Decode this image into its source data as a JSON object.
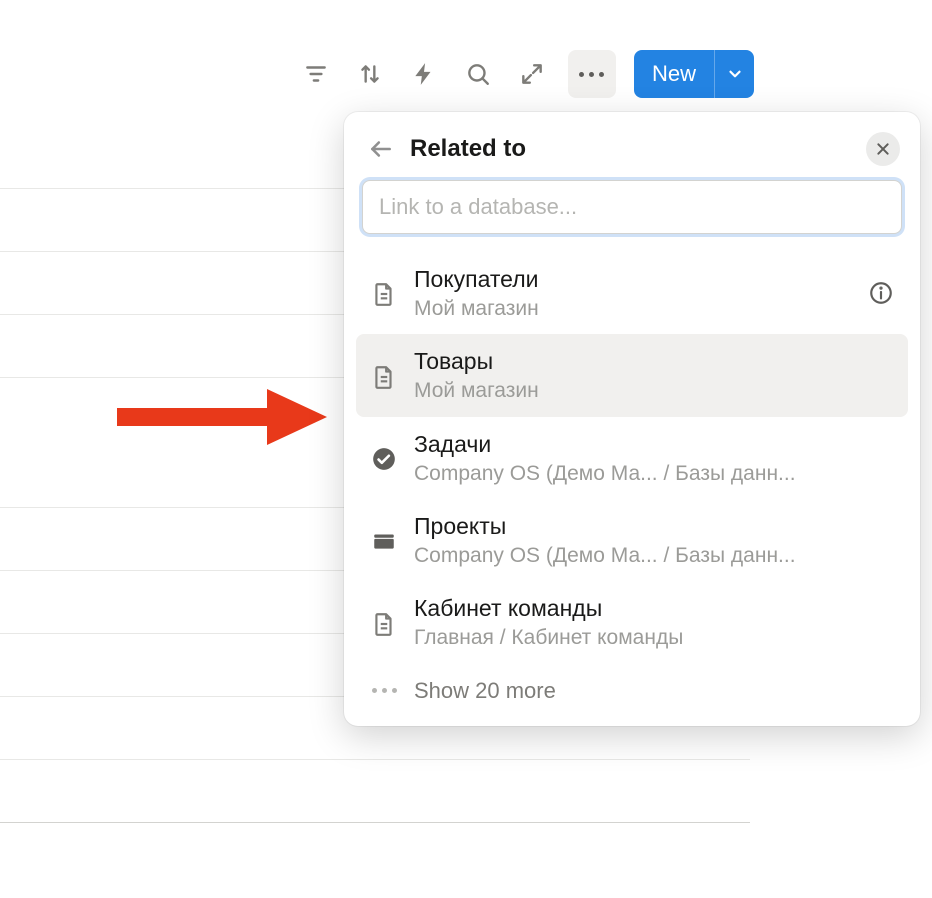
{
  "toolbar": {
    "new_label": "New"
  },
  "popover": {
    "title": "Related to",
    "search_placeholder": "Link to a database...",
    "items": [
      {
        "title": "Покупатели",
        "subtitle": "Мой магазин",
        "icon": "page",
        "info": true
      },
      {
        "title": "Товары",
        "subtitle": "Мой магазин",
        "icon": "page",
        "hover": true
      },
      {
        "title": "Задачи",
        "subtitle": "Company OS (Демо Ма... / Базы данн...",
        "icon": "check"
      },
      {
        "title": "Проекты",
        "subtitle": "Company OS (Демо Ма... / Базы данн...",
        "icon": "folder"
      },
      {
        "title": "Кабинет команды",
        "subtitle": "Главная / Кабинет команды",
        "icon": "page"
      }
    ],
    "show_more": "Show 20 more"
  }
}
